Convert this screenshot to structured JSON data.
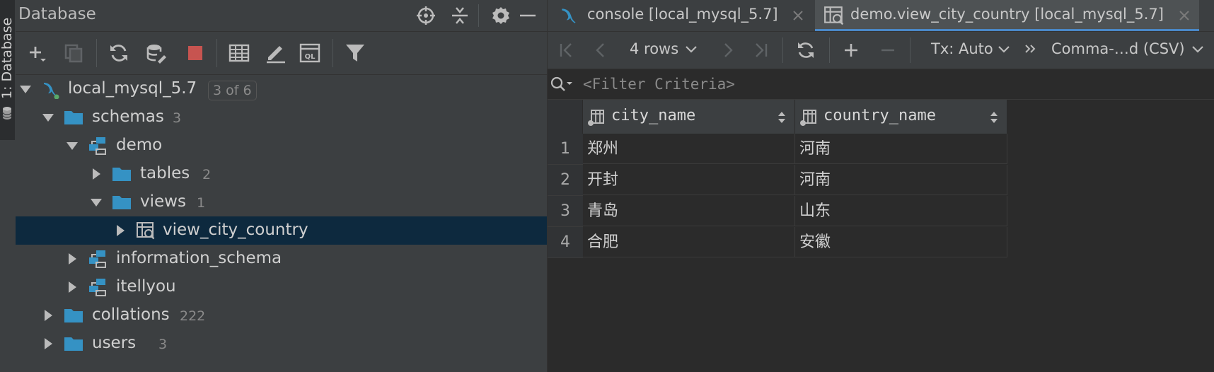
{
  "side_stripe": {
    "label": "1: Database"
  },
  "db_panel": {
    "title": "Database",
    "tree": [
      {
        "label": "local_mysql_5.7",
        "badge": "3 of 6"
      },
      {
        "label": "schemas",
        "count": "3"
      },
      {
        "label": "demo"
      },
      {
        "label": "tables",
        "count": "2"
      },
      {
        "label": "views",
        "count": "1"
      },
      {
        "label": "view_city_country"
      },
      {
        "label": "information_schema"
      },
      {
        "label": "itellyou"
      },
      {
        "label": "collations",
        "count": "222"
      },
      {
        "label": "users",
        "count": "3"
      }
    ]
  },
  "tabs": [
    {
      "label": "console [local_mysql_5.7]"
    },
    {
      "label": "demo.view_city_country [local_mysql_5.7]"
    }
  ],
  "result_toolbar": {
    "rows_label": "4 rows",
    "tx_label": "Tx: Auto",
    "export_label": "Comma-…d (CSV)"
  },
  "filter": {
    "placeholder": "<Filter Criteria>"
  },
  "grid": {
    "columns": [
      "city_name",
      "country_name"
    ],
    "rows": [
      {
        "num": "1",
        "cells": [
          "郑州",
          "河南"
        ]
      },
      {
        "num": "2",
        "cells": [
          "开封",
          "河南"
        ]
      },
      {
        "num": "3",
        "cells": [
          "青岛",
          "山东"
        ]
      },
      {
        "num": "4",
        "cells": [
          "合肥",
          "安徽"
        ]
      }
    ]
  },
  "colors": {
    "panel_bg": "#3c3f41",
    "editor_bg": "#2b2b2b",
    "selection": "#0d293e",
    "folder": "#3592c4",
    "accent_blue": "#4a88c7",
    "stop_red": "#c75450"
  }
}
